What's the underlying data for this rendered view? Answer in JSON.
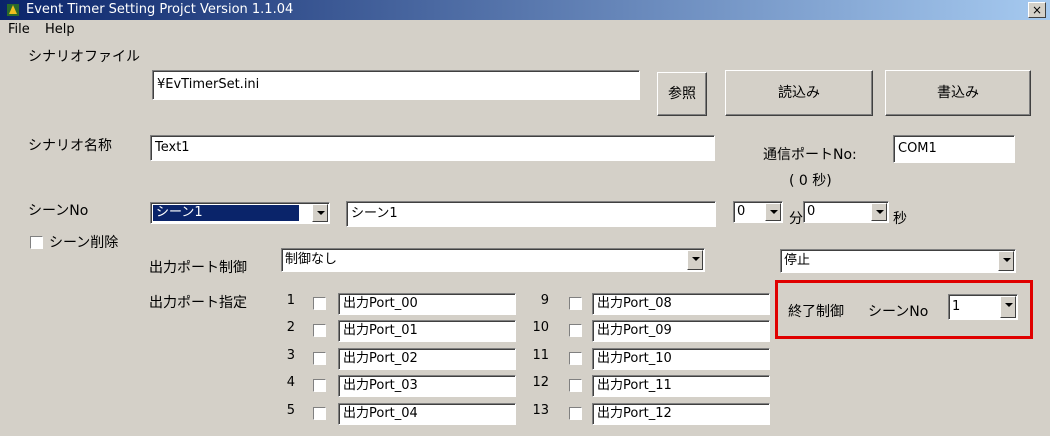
{
  "window": {
    "title": "Event Timer Setting Projct Version 1.1.04",
    "close_glyph": "×"
  },
  "menu": {
    "items": [
      "File",
      "Help"
    ]
  },
  "scenario_file": {
    "label": "シナリオファイル",
    "value": "¥EvTimerSet.ini",
    "browse": "参照",
    "load": "読込み",
    "write": "書込み"
  },
  "scenario_name": {
    "label": "シナリオ名称",
    "value": "Text1"
  },
  "comm_port": {
    "label": "通信ポートNo:",
    "value": "COM1",
    "seconds_note": "( 0 秒)"
  },
  "scene": {
    "label": "シーンNo",
    "selected": "シーン1",
    "name": "シーン1",
    "minutes": "0",
    "minutes_unit": "分",
    "seconds": "0",
    "seconds_unit": "秒",
    "delete_label": "シーン削除"
  },
  "output_control": {
    "label": "出力ポート制御",
    "value": "制御なし",
    "state": "停止"
  },
  "output_ports": {
    "label": "出力ポート指定",
    "left": [
      {
        "n": "1",
        "name": "出力Port_00"
      },
      {
        "n": "2",
        "name": "出力Port_01"
      },
      {
        "n": "3",
        "name": "出力Port_02"
      },
      {
        "n": "4",
        "name": "出力Port_03"
      },
      {
        "n": "5",
        "name": "出力Port_04"
      }
    ],
    "right": [
      {
        "n": "9",
        "name": "出力Port_08"
      },
      {
        "n": "10",
        "name": "出力Port_09"
      },
      {
        "n": "11",
        "name": "出力Port_10"
      },
      {
        "n": "12",
        "name": "出力Port_11"
      },
      {
        "n": "13",
        "name": "出力Port_12"
      }
    ]
  },
  "end_control": {
    "label": "終了制御",
    "scene_label": "シーンNo",
    "value": "1",
    "highlight_color": "#e00000"
  }
}
